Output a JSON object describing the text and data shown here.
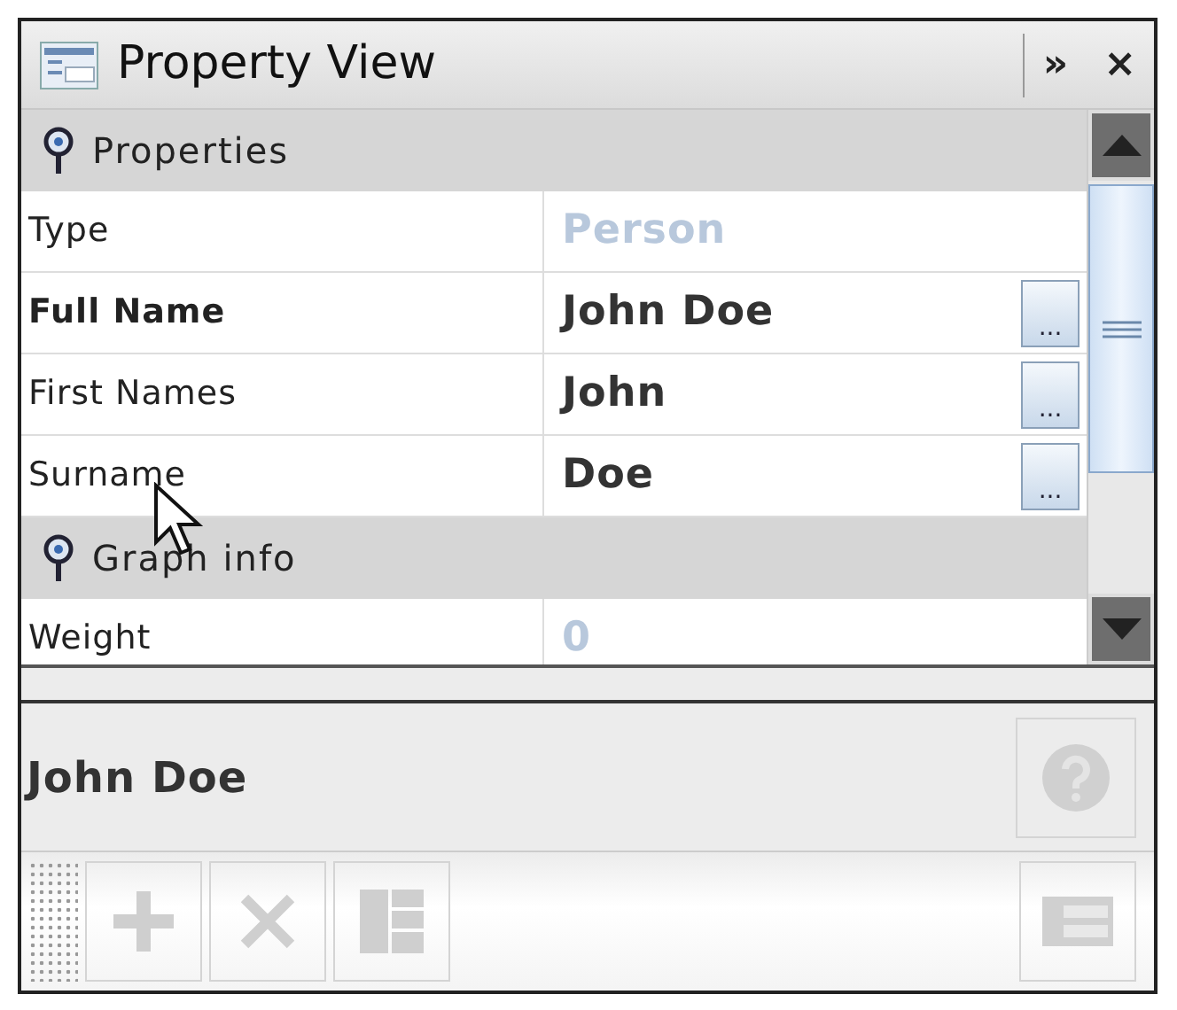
{
  "window": {
    "title": "Property View",
    "controls": [
      "»",
      "×"
    ]
  },
  "sections": [
    {
      "title": "Properties",
      "expanded": true,
      "rows": [
        {
          "label": "Type",
          "value": "Person",
          "modified": false,
          "editable": false
        },
        {
          "label": "Full Name",
          "value": "John Doe",
          "modified": true,
          "editable": true,
          "button": "..."
        },
        {
          "label": "First Names",
          "value": "John",
          "modified": false,
          "editable": true,
          "button": "..."
        },
        {
          "label": "Surname",
          "value": "Doe",
          "modified": false,
          "editable": true,
          "button": "..."
        }
      ]
    },
    {
      "title": "Graph info",
      "expanded": true,
      "rows": [
        {
          "label": "Weight",
          "value": "0",
          "modified": false,
          "editable": false
        }
      ]
    }
  ],
  "description": {
    "title": "John Doe",
    "help_disabled": true
  },
  "toolbar": [
    {
      "kind": "add",
      "disabled": true
    },
    {
      "kind": "delete",
      "disabled": true
    },
    {
      "kind": "grid",
      "disabled": true
    }
  ],
  "view_toggle": {
    "disabled": true
  }
}
